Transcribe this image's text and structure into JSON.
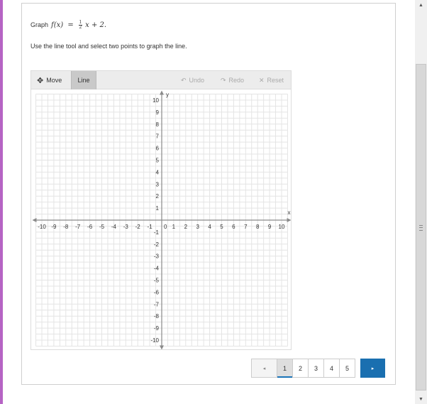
{
  "question": {
    "prefix": "Graph",
    "function_lhs": "f(x)",
    "equals": "=",
    "frac_num": "1",
    "frac_den": "2",
    "rest": "x + 2."
  },
  "instruction": "Use the line tool and select two points to graph the line.",
  "toolbar": {
    "move_label": "Move",
    "line_label": "Line",
    "undo_label": "Undo",
    "redo_label": "Redo",
    "reset_label": "Reset",
    "move_icon": "move-arrows-icon",
    "undo_icon": "undo-arrow-icon",
    "redo_icon": "redo-arrow-icon",
    "reset_icon": "x-icon"
  },
  "graph": {
    "x_axis_label": "x",
    "y_axis_label": "y",
    "x_range": [
      -10,
      10
    ],
    "y_range": [
      -10,
      10
    ],
    "grid": true,
    "x_ticks": [
      "-10",
      "-9",
      "-8",
      "-7",
      "-6",
      "-5",
      "-4",
      "-3",
      "-2",
      "-1",
      "0",
      "1",
      "2",
      "3",
      "4",
      "5",
      "6",
      "7",
      "8",
      "9",
      "10"
    ],
    "y_ticks": [
      "10",
      "9",
      "8",
      "7",
      "6",
      "5",
      "4",
      "3",
      "2",
      "1",
      "-1",
      "-2",
      "-3",
      "-4",
      "-5",
      "-6",
      "-7",
      "-8",
      "-9",
      "-10"
    ],
    "colors": {
      "grid": "#e4e4e4",
      "axis": "#8a8a8a",
      "label": "#333333"
    }
  },
  "pager": {
    "prev_glyph": "◂",
    "pages": [
      "1",
      "2",
      "3",
      "4",
      "5"
    ],
    "active_page": "1",
    "next_glyph": "▸"
  },
  "colors": {
    "accent": "#b664c4",
    "pager_next": "#1a6fb0",
    "active_underline": "#1a73b8"
  }
}
